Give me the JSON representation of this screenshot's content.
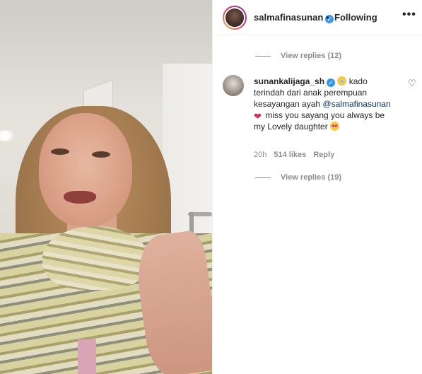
{
  "header": {
    "username": "salmafinasunan",
    "separator": "•",
    "follow_state": "Following",
    "more_glyph": "•••",
    "verified_glyph": "✓"
  },
  "thread": {
    "view_replies_top": "View replies (12)",
    "view_replies_bottom": "View replies (19)"
  },
  "comment": {
    "username": "sunankalijaga_sh",
    "verified_glyph": "✓",
    "text_part1": "kado terindah dari anak perempuan kesayangan ayah",
    "mention": "@salmafinasunan",
    "heart_glyph": "❤",
    "text_part2": "miss you sayang you always be my Lovely daughter",
    "like_glyph": "♡",
    "time": "20h",
    "likes": "514 likes",
    "reply_label": "Reply"
  },
  "colors": {
    "verified": "#3897f0",
    "muted": "#8e8e8e",
    "mention": "#00376b",
    "text": "#262626"
  },
  "icons": {
    "verified": "verified-badge-icon",
    "more": "more-options-icon",
    "like": "heart-outline-icon"
  }
}
